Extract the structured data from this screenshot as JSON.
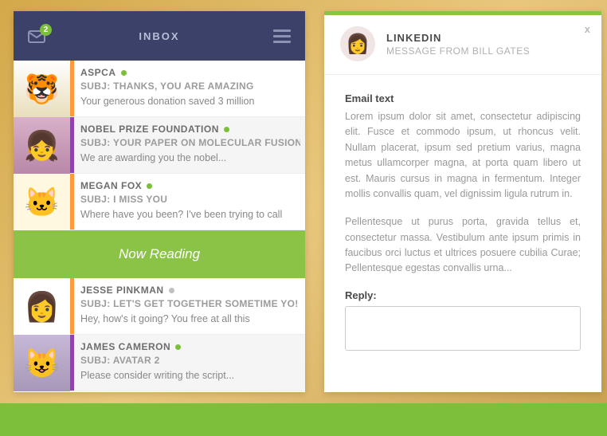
{
  "inbox": {
    "title": "INBOX",
    "badge": "2",
    "nowReading": "Now Reading",
    "messages": [
      {
        "sender": "ASPCA",
        "subject": "SUBJ: THANKS, YOU ARE AMAZING",
        "preview": "Your generous donation saved 3 million",
        "barColor": "#ff9a3c",
        "statusColor": "#7bbf3a",
        "avatarEmoji": "🐯",
        "alt": false
      },
      {
        "sender": "NOBEL PRIZE FOUNDATION",
        "subject": "SUBJ: YOUR PAPER ON MOLECULAR FUSION",
        "preview": "We are awarding you the nobel...",
        "barColor": "#8e44ad",
        "statusColor": "#7bbf3a",
        "avatarEmoji": "👧",
        "alt": true
      },
      {
        "sender": "MEGAN FOX",
        "subject": "SUBJ: I MISS YOU",
        "preview": "Where have you been? I've been trying to call",
        "barColor": "#ff9a3c",
        "statusColor": "#7bbf3a",
        "avatarEmoji": "🐱",
        "alt": false
      },
      {
        "sender": "JESSE PINKMAN",
        "subject": "SUBJ: LET'S GET TOGETHER SOMETIME YO!",
        "preview": "Hey, how's it going? You free at all this",
        "barColor": "#ff9a3c",
        "statusColor": "#c0c0c0",
        "avatarEmoji": "👩",
        "alt": false
      },
      {
        "sender": "JAMES CAMERON",
        "subject": "SUBJ: AVATAR 2",
        "preview": "Please consider writing the script...",
        "barColor": "#8e44ad",
        "statusColor": "#7bbf3a",
        "avatarEmoji": "😺",
        "alt": true
      }
    ]
  },
  "detail": {
    "sender": "LINKEDIN",
    "from": "MESSAGE FROM BILL GATES",
    "close": "x",
    "bodyLabel": "Email text",
    "paragraph1": "Lorem ipsum dolor sit amet, consectetur adipiscing elit. Fusce et commodo ipsum, ut rhoncus velit. Nullam placerat, ipsum sed pretium varius, magna metus ullamcorper magna, at porta quam libero ut est. Mauris cursus in magna in fermentum. Integer mollis convallis quam, vel dignissim ligula rutrum in.",
    "paragraph2": "Pellentesque ut purus porta, gravida tellus et, consectetur massa. Vestibulum ante ipsum primis in faucibus orci luctus et ultrices posuere cubilia Curae; Pellentesque egestas convallis urna...",
    "replyLabel": "Reply:",
    "avatarEmoji": "👩"
  }
}
